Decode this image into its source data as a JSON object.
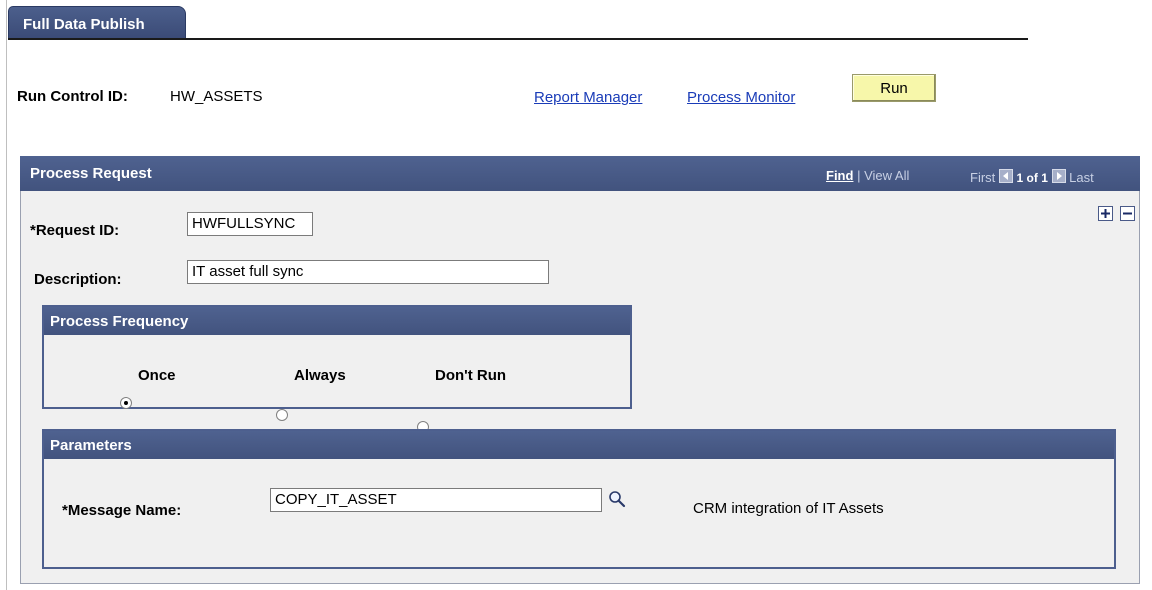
{
  "tab": {
    "label": "Full Data Publish"
  },
  "run_control": {
    "label": "Run Control ID:",
    "value": "HW_ASSETS"
  },
  "links": {
    "report_manager": "Report Manager",
    "process_monitor": "Process Monitor"
  },
  "run_button": {
    "label": "Run"
  },
  "process_request": {
    "title": "Process Request",
    "find": "Find",
    "separator": "|",
    "view_all": "View All",
    "first": "First",
    "counter": "1 of 1",
    "last": "Last",
    "request_id_label": "*Request ID:",
    "request_id_value": "HWFULLSYNC",
    "description_label": "Description:",
    "description_value": "IT asset full sync"
  },
  "process_frequency": {
    "title": "Process Frequency",
    "options": [
      "Once",
      "Always",
      "Don't Run"
    ],
    "selected": "Once"
  },
  "parameters": {
    "title": "Parameters",
    "message_name_label": "*Message Name:",
    "message_name_value": "COPY_IT_ASSET",
    "message_description": "CRM integration of IT Assets"
  },
  "icons": {
    "lookup": "magnifier-icon",
    "add_row": "plus-icon",
    "delete_row": "minus-icon",
    "prev": "left-arrow-icon",
    "next": "right-arrow-icon"
  },
  "colors": {
    "header": "#46578a",
    "link": "#1a3cb8",
    "run_button": "#f7f7aa"
  }
}
